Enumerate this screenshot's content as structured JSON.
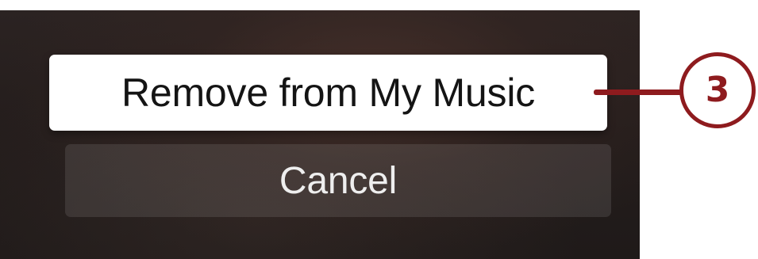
{
  "dialog": {
    "primary_action_label": "Remove from My Music",
    "cancel_label": "Cancel"
  },
  "callout": {
    "number": "3",
    "color": "#8e1b1e"
  }
}
